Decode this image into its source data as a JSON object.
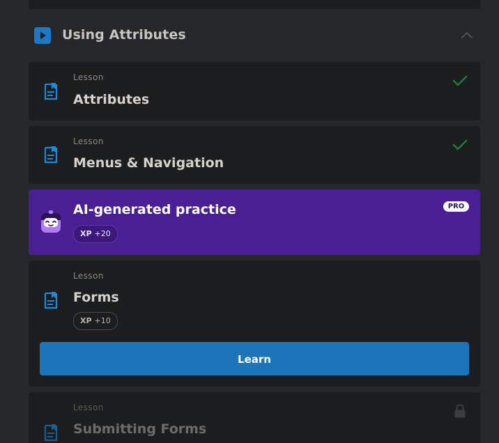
{
  "section": {
    "title": "Using Attributes",
    "icon": "play-icon",
    "toggle_icon": "chevron-up-icon"
  },
  "lessons": [
    {
      "label": "Lesson",
      "title": "Attributes",
      "status": "completed"
    },
    {
      "label": "Lesson",
      "title": "Menus & Navigation",
      "status": "completed"
    },
    {
      "label": "Lesson",
      "title": "Forms",
      "status": "current",
      "xp_label": "XP",
      "xp_value": "+10",
      "button_label": "Learn"
    },
    {
      "label": "Lesson",
      "title": "Submitting Forms",
      "status": "locked"
    }
  ],
  "practice": {
    "title": "AI-generated practice",
    "badge": "PRO",
    "xp_label": "XP",
    "xp_value": "+20"
  },
  "colors": {
    "page_bg": "#25272a",
    "card_bg": "#1c1d1f",
    "accent_blue": "#1c75b9",
    "practice_purple": "#4a1f94",
    "check_green": "#1f7a3a"
  }
}
